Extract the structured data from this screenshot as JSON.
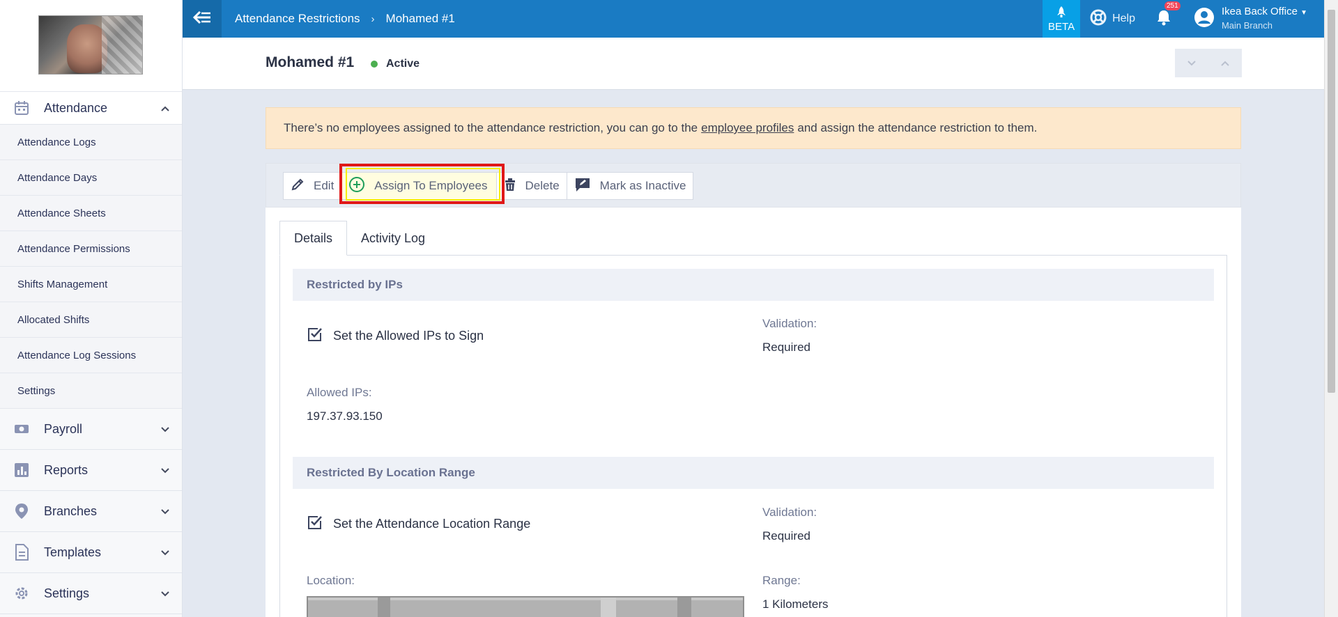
{
  "sidebar": {
    "section_attendance": "Attendance",
    "items": [
      {
        "label": "Attendance Logs"
      },
      {
        "label": "Attendance Days"
      },
      {
        "label": "Attendance Sheets"
      },
      {
        "label": "Attendance Permissions"
      },
      {
        "label": "Shifts Management"
      },
      {
        "label": "Allocated Shifts"
      },
      {
        "label": "Attendance Log Sessions"
      },
      {
        "label": "Settings"
      }
    ],
    "sections": [
      {
        "label": "Payroll"
      },
      {
        "label": "Reports"
      },
      {
        "label": "Branches"
      },
      {
        "label": "Templates"
      },
      {
        "label": "Settings"
      }
    ]
  },
  "topbar": {
    "crumb1": "Attendance Restrictions",
    "crumb_sep": "›",
    "crumb2": "Mohamed #1",
    "beta": "BETA",
    "help": "Help",
    "notif_count": "251",
    "user_name": "Ikea Back Office",
    "user_branch": "Main Branch"
  },
  "header": {
    "title": "Mohamed #1",
    "status": "Active"
  },
  "alert": {
    "text_before": "There’s no employees assigned to the attendance restriction, you can go to the",
    "link": "employee profiles",
    "text_after": "and assign the attendance restriction to them."
  },
  "actions": {
    "edit": "Edit",
    "assign": "Assign To Employees",
    "delete": "Delete",
    "inactive": "Mark as Inactive"
  },
  "tabs": {
    "details": "Details",
    "activity": "Activity Log"
  },
  "ips": {
    "section": "Restricted by IPs",
    "check_label": "Set the Allowed IPs to Sign",
    "validation_label": "Validation:",
    "validation_value": "Required",
    "allowed_label": "Allowed IPs:",
    "allowed_value": "197.37.93.150"
  },
  "location": {
    "section": "Restricted By Location Range",
    "check_label": "Set the Attendance Location Range",
    "validation_label": "Validation:",
    "validation_value": "Required",
    "location_label": "Location:",
    "range_label": "Range:",
    "range_value": "1 Kilometers"
  },
  "colors": {
    "topbar": "#1a7bc3",
    "beta": "#08a0e6",
    "status_active": "#4caf50",
    "alert_bg": "#fde8cc",
    "highlight_red": "#e01818",
    "highlight_yellow": "#f5ef00"
  }
}
